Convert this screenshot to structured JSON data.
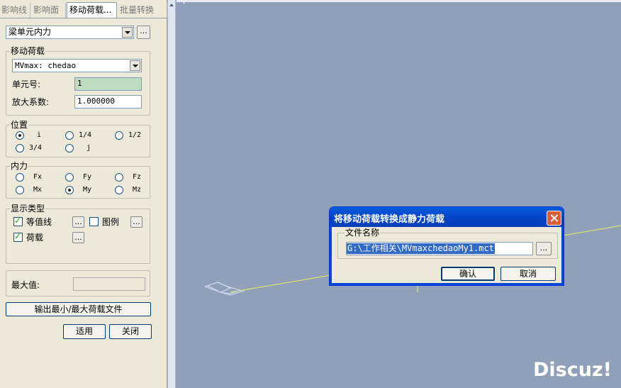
{
  "tabs": [
    {
      "label": "影响线",
      "active": false
    },
    {
      "label": "影响面",
      "active": false
    },
    {
      "label": "移动荷载...",
      "active": true
    },
    {
      "label": "批量转换",
      "active": false
    }
  ],
  "panel": {
    "type_select": {
      "value": "梁单元内力",
      "more_button": "..."
    },
    "moving_load": {
      "title": "移动荷载",
      "case_select": "MVmax: chedao",
      "element_label": "单元号:",
      "element_value": "1",
      "scale_label": "放大系数:",
      "scale_value": "1.000000"
    },
    "position": {
      "title": "位置",
      "options": [
        {
          "label": "i",
          "checked": true
        },
        {
          "label": "1/4",
          "checked": false
        },
        {
          "label": "1/2",
          "checked": false
        },
        {
          "label": "3/4",
          "checked": false
        },
        {
          "label": "j",
          "checked": false
        }
      ]
    },
    "force": {
      "title": "内力",
      "options": [
        {
          "label": "Fx",
          "checked": false
        },
        {
          "label": "Fy",
          "checked": false
        },
        {
          "label": "Fz",
          "checked": false
        },
        {
          "label": "Mx",
          "checked": false
        },
        {
          "label": "My",
          "checked": true
        },
        {
          "label": "Mz",
          "checked": false
        }
      ]
    },
    "display": {
      "title": "显示类型",
      "contour_label": "等值线",
      "contour_checked": true,
      "legend_label": "图例",
      "legend_checked": false,
      "load_label": "荷载",
      "load_checked": true,
      "more_button": "..."
    },
    "max_label": "最大值:",
    "max_value": "",
    "export_button": "输出最小/最大荷载文件",
    "apply_button": "适用",
    "close_button": "关闭"
  },
  "dialog": {
    "title": "将移动荷载转换成静力荷载",
    "group_title": "文件名称",
    "filename": "G:\\工作相关\\MVmaxchedaoMy1.mct",
    "browse_button": "...",
    "ok_button": "确认",
    "cancel_button": "取消"
  },
  "watermark": "Discuz!",
  "colors": {
    "viewport_bg": "#8fa0b8",
    "model_line": "#e8f060",
    "title_bar": "#0046c8",
    "selection": "#316ac5"
  }
}
